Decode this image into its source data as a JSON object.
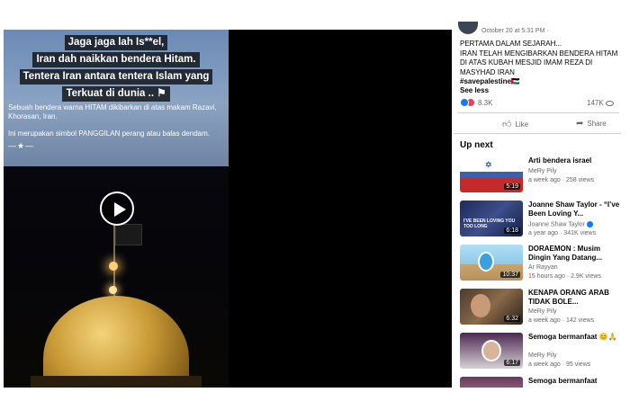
{
  "video": {
    "overlay_lines": [
      "Jaga jaga lah Is**el,",
      "Iran dah naikkan bendera Hitam.",
      "Tentera Iran antara tentera Islam yang",
      "Terkuat di dunia .. ⚑"
    ],
    "description_line1": "Sebuah bendera warna HITAM dikibarkan di atas makam Razavi, Khorasan, Iran.",
    "description_line2": "Ini merupakan simbol PANGGILAN perang atau balas dendam.",
    "emoji_row": "—★—"
  },
  "post": {
    "date": "October 20 at 5:31 PM ·",
    "text_lines": [
      "PERTAMA DALAM SEJARAH...",
      "IRAN TELAH MENGIBARKAN BENDERA HITAM",
      "DI ATAS KUBAH MESJID IMAM REZA DI",
      "MASYHAD IRAN"
    ],
    "hashtag": "#savepalestine🇵🇸",
    "see_less": "See less",
    "reaction_count": "8.3K",
    "view_count": "147K",
    "like_label": "Like",
    "share_label": "Share"
  },
  "up_next": {
    "heading": "Up next",
    "items": [
      {
        "title": "Arti bendera israel",
        "channel": "MeRy Pily",
        "meta": "a week ago · 258 views",
        "duration": "5:19"
      },
      {
        "title": "Joanne Shaw Taylor - “I’ve Been Loving Y...",
        "channel": "Joanne Shaw Taylor",
        "meta": "a year ago · 341K views",
        "duration": "6:18",
        "thumb_text": "I'VE BEEN LOVING YOU TOO LONG"
      },
      {
        "title": "DORAEMON : Musim Dingin Yang Datang...",
        "channel": "Ar Rayyan",
        "meta": "15 hours ago · 2.9K views",
        "duration": "10:37"
      },
      {
        "title": "KENAPA ORANG ARAB TIDAK BOLE...",
        "channel": "MeRy Pily",
        "meta": "a week ago · 142 views",
        "duration": "6:32"
      },
      {
        "title": "Semoga bermanfaat 😊🙏",
        "channel": "MeRy Pily",
        "meta": "a week ago · 95 views",
        "duration": "6:17"
      },
      {
        "title": "Semoga bermanfaat",
        "channel": "",
        "meta": "",
        "duration": ""
      }
    ]
  },
  "colors": {
    "accent": "#1877f2",
    "love": "#f33e58",
    "secondary_text": "#65676b"
  }
}
